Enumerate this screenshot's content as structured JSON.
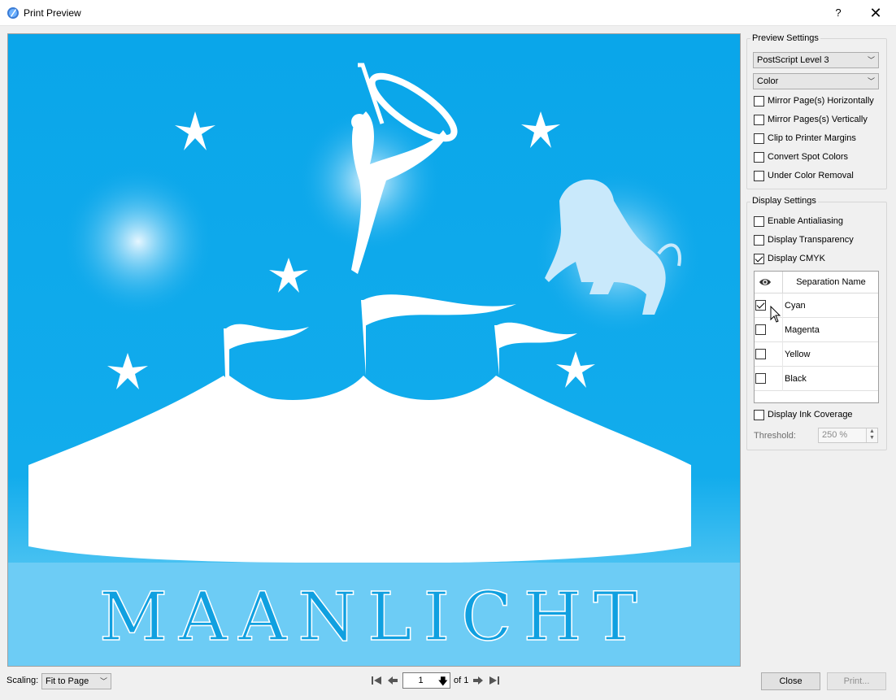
{
  "window": {
    "title": "Print Preview",
    "help_label": "?",
    "close_label": "✕"
  },
  "preview_image": {
    "text": "MAANLICHT"
  },
  "preview_settings": {
    "group_label": "Preview Settings",
    "postscript_level": "PostScript Level 3",
    "color_mode": "Color",
    "options": [
      {
        "label": "Mirror Page(s) Horizontally",
        "checked": false
      },
      {
        "label": "Mirror Pages(s) Vertically",
        "checked": false
      },
      {
        "label": "Clip to Printer Margins",
        "checked": false
      },
      {
        "label": "Convert Spot Colors",
        "checked": false
      },
      {
        "label": "Under Color Removal",
        "checked": false
      }
    ]
  },
  "display_settings": {
    "group_label": "Display Settings",
    "options": [
      {
        "label": "Enable Antialiasing",
        "checked": false
      },
      {
        "label": "Display Transparency",
        "checked": false
      },
      {
        "label": "Display CMYK",
        "checked": true
      }
    ],
    "separations": {
      "header": "Separation Name",
      "rows": [
        {
          "name": "Cyan",
          "visible": true
        },
        {
          "name": "Magenta",
          "visible": false
        },
        {
          "name": "Yellow",
          "visible": false
        },
        {
          "name": "Black",
          "visible": false
        }
      ]
    },
    "ink_coverage": {
      "label": "Display Ink Coverage",
      "checked": false
    },
    "threshold": {
      "label": "Threshold:",
      "value": "250 %"
    }
  },
  "footer": {
    "scaling_label": "Scaling:",
    "scaling_value": "Fit to Page",
    "page_number": "1",
    "page_total_text": "of 1",
    "close_button": "Close",
    "print_button": "Print..."
  }
}
